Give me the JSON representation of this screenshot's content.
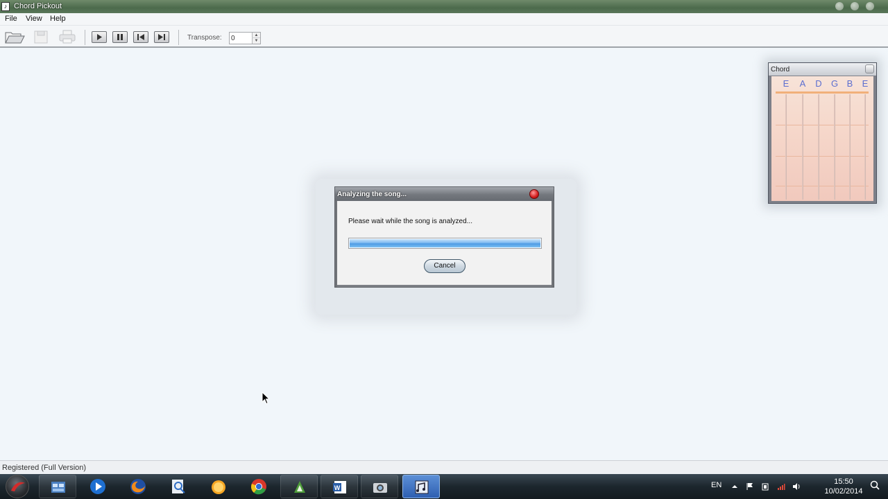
{
  "window": {
    "title": "Chord Pickout"
  },
  "menu": [
    "File",
    "View",
    "Help"
  ],
  "toolbar": {
    "transpose_label": "Transpose:",
    "transpose_value": "0"
  },
  "chord_panel": {
    "title": "Chord",
    "strings": [
      "E",
      "A",
      "D",
      "G",
      "B",
      "E"
    ]
  },
  "dialog": {
    "title": "Analyzing the song...",
    "message": "Please wait while the song is analyzed...",
    "progress_percent": 100,
    "cancel_label": "Cancel"
  },
  "status": {
    "text": "Registered (Full Version)"
  },
  "taskbar": {
    "language": "EN",
    "time": "15:50",
    "date": "10/02/2014"
  },
  "colors": {
    "progress": "#4e9be4",
    "string_letters": "#5b6ed0",
    "taskbar_active": "#2e5fb1"
  }
}
